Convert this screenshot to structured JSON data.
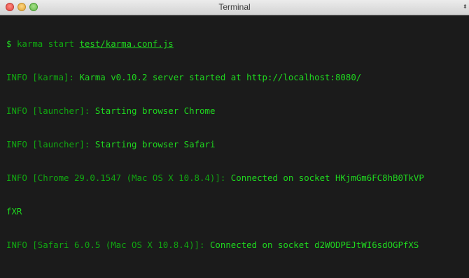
{
  "window": {
    "title": "Terminal",
    "resize_glyph": "⬍"
  },
  "colors": {
    "background": "#1b1b1b",
    "text_bright": "#1fd81f",
    "text_dim": "#11a811"
  },
  "terminal": {
    "prompt_symbol": "$",
    "command": "karma start",
    "command_arg": "test/karma.conf.js",
    "lines": [
      {
        "prefix": "INFO [karma]: ",
        "message": "Karma v0.10.2 server started at http://localhost:8080/"
      },
      {
        "prefix": "INFO [launcher]: ",
        "message": "Starting browser Chrome"
      },
      {
        "prefix": "INFO [launcher]: ",
        "message": "Starting browser Safari"
      },
      {
        "prefix": "INFO [Chrome 29.0.1547 (Mac OS X 10.8.4)]: ",
        "message": "Connected on socket HKjmGm6FC8hB0TkVP"
      },
      {
        "prefix": "",
        "message": "fXR"
      },
      {
        "prefix": "INFO [Safari 6.0.5 (Mac OS X 10.8.4)]: ",
        "message": "Connected on socket d2WODPEJtWI6sdOGPfXS"
      }
    ]
  }
}
